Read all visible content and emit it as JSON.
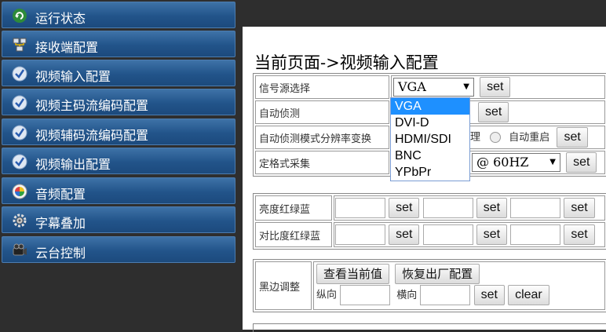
{
  "sidebar": {
    "items": [
      {
        "label": "运行状态",
        "icon": "recycle-icon"
      },
      {
        "label": "接收端配置",
        "icon": "network-icon"
      },
      {
        "label": "视频输入配置",
        "icon": "check-icon"
      },
      {
        "label": "视频主码流编码配置",
        "icon": "check-icon"
      },
      {
        "label": "视频辅码流编码配置",
        "icon": "check-icon"
      },
      {
        "label": "视频输出配置",
        "icon": "check-icon"
      },
      {
        "label": "音频配置",
        "icon": "audio-icon"
      },
      {
        "label": "字幕叠加",
        "icon": "gear-icon"
      },
      {
        "label": "云台控制",
        "icon": "camera-icon"
      }
    ]
  },
  "page": {
    "title": "当前页面->视频输入配置"
  },
  "signal": {
    "label": "信号源选择",
    "selected": "VGA",
    "set": "set",
    "options": [
      "VGA",
      "DVI-D",
      "HDMI/SDI",
      "BNC",
      "YPbPr"
    ]
  },
  "auto_detect": {
    "label": "自动侦测",
    "set": "set"
  },
  "auto_mode": {
    "label": "自动侦测模式分辨率变换",
    "opt1": "理",
    "opt2": "自动重启",
    "set": "set"
  },
  "fixed": {
    "label": "定格式采集",
    "value": "@ 60HZ",
    "set": "set"
  },
  "color": {
    "brightness_label": "亮度红绿蓝",
    "contrast_label": "对比度红绿蓝",
    "set": "set"
  },
  "border": {
    "label": "黑边调整",
    "view_btn": "查看当前值",
    "restore_btn": "恢复出厂配置",
    "vertical": "纵向",
    "horizontal": "横向",
    "set": "set",
    "clear": "clear"
  },
  "colors": {
    "sidebar_bg": "#22548a",
    "selected": "#1e90ff"
  }
}
